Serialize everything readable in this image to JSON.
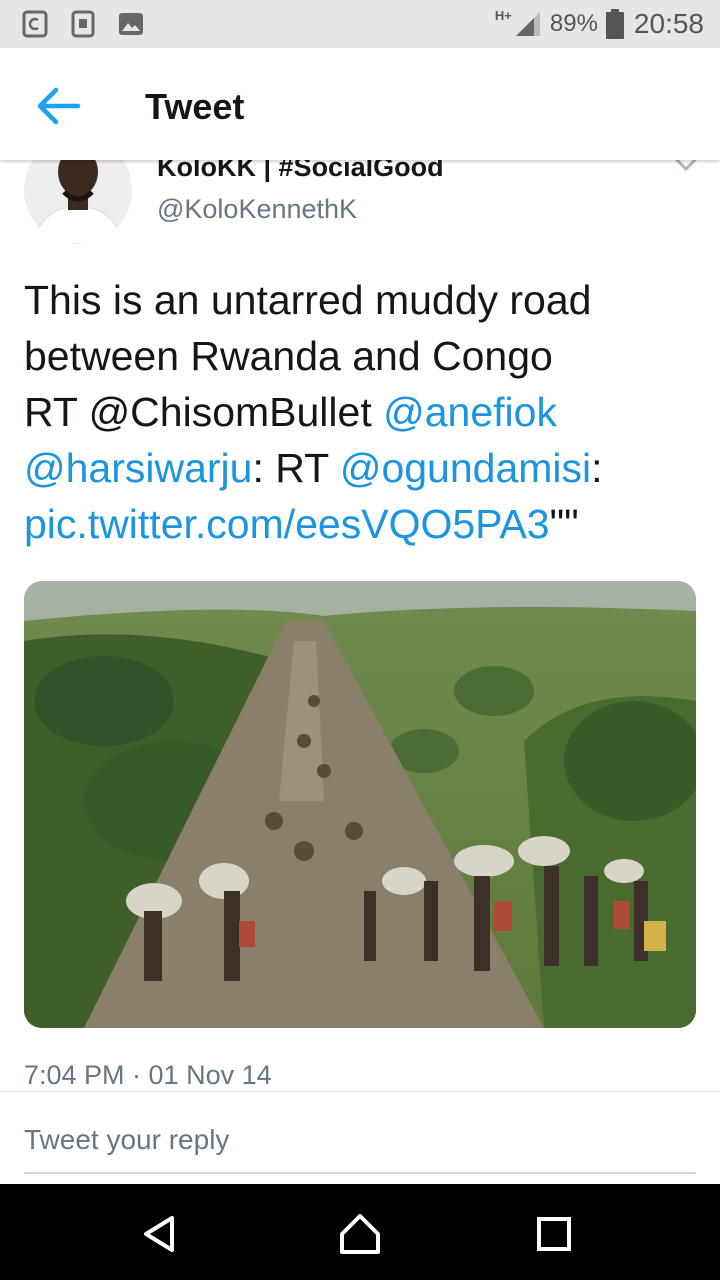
{
  "status_bar": {
    "network": "H+",
    "battery": "89%",
    "time": "20:58",
    "left_icons": [
      "notification-app-icon",
      "notification-sim-icon",
      "notification-image-icon"
    ],
    "right_icons": [
      "signal-icon",
      "battery-icon"
    ]
  },
  "app_bar": {
    "back_icon": "arrow-left-icon",
    "title": "Tweet"
  },
  "tweet": {
    "display_name": "KoloKK | #SocialGood",
    "handle": "@KoloKennethK",
    "menu_icon": "chevron-down-icon",
    "text_lines": [
      [
        {
          "text": "This is an untarred muddy road",
          "link": false
        }
      ],
      [
        {
          "text": "between Rwanda and Congo",
          "link": false
        }
      ],
      [
        {
          "text": "RT  @ChisomBullet ",
          "link": false
        },
        {
          "text": "@anefiok",
          "link": true
        }
      ],
      [
        {
          "text": "@harsiwarju",
          "link": true
        },
        {
          "text": ": RT ",
          "link": false
        },
        {
          "text": "@ogundamisi",
          "link": true
        },
        {
          "text": ":",
          "link": false
        }
      ],
      [
        {
          "text": "pic.twitter.com/eesVQO5PA3",
          "link": true
        },
        {
          "text": "\"\"",
          "link": false
        }
      ]
    ],
    "timestamp": "7:04 PM · 01 Nov 14"
  },
  "reply": {
    "placeholder": "Tweet your reply"
  },
  "nav_bar": {
    "icons": [
      "back-triangle-icon",
      "home-icon",
      "recents-icon"
    ]
  },
  "colors": {
    "link": "#1b95e0",
    "secondary_text": "#657786",
    "primary_text": "#14171a",
    "status_bar_bg": "#e6e6e6",
    "nav_bar_bg": "#000000"
  }
}
